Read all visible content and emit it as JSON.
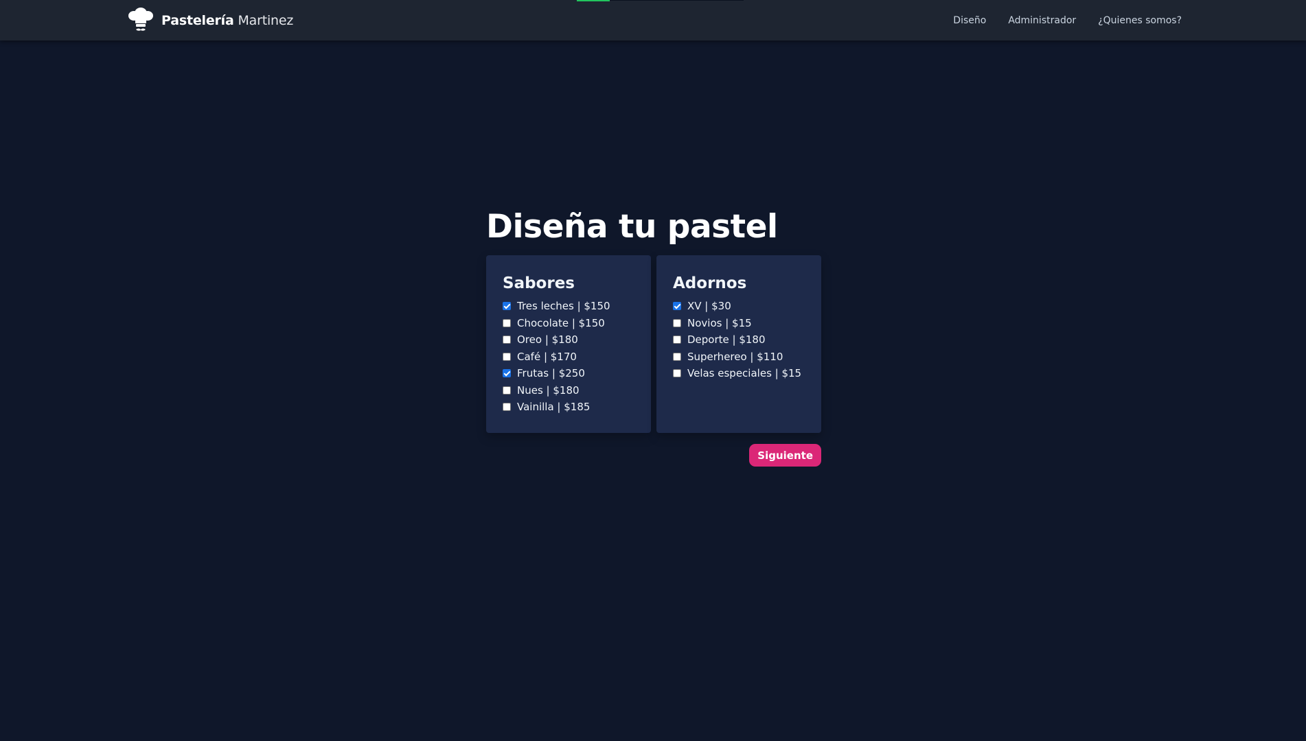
{
  "navbar": {
    "brand_bold": "Pastelería",
    "brand_light": " Martinez",
    "logo_icon": "chef-hat-mustache-icon",
    "links": [
      "Diseño",
      "Administrador",
      "¿Quienes somos?"
    ]
  },
  "main": {
    "title": "Diseña tu pastel",
    "sabores": {
      "title": "Sabores",
      "options": [
        {
          "label": "Tres leches | $150",
          "checked": true
        },
        {
          "label": "Chocolate | $150",
          "checked": false
        },
        {
          "label": "Oreo | $180",
          "checked": false
        },
        {
          "label": "Café | $170",
          "checked": false
        },
        {
          "label": "Frutas | $250",
          "checked": true
        },
        {
          "label": "Nues | $180",
          "checked": false
        },
        {
          "label": "Vainilla | $185",
          "checked": false
        }
      ]
    },
    "adornos": {
      "title": "Adornos",
      "options": [
        {
          "label": "XV | $30",
          "checked": true
        },
        {
          "label": "Novios | $15",
          "checked": false
        },
        {
          "label": "Deporte | $180",
          "checked": false
        },
        {
          "label": "Superhereo | $110",
          "checked": false
        },
        {
          "label": "Velas especiales | $15",
          "checked": false
        }
      ]
    },
    "next_button": "Siguiente"
  },
  "colors": {
    "background": "#0f172a",
    "navbar": "#1e2531",
    "card": "#1e2a4a",
    "accent_button": "#db2777",
    "checkbox_checked": "#1a73e8",
    "nav_accent": "#22c55e"
  }
}
